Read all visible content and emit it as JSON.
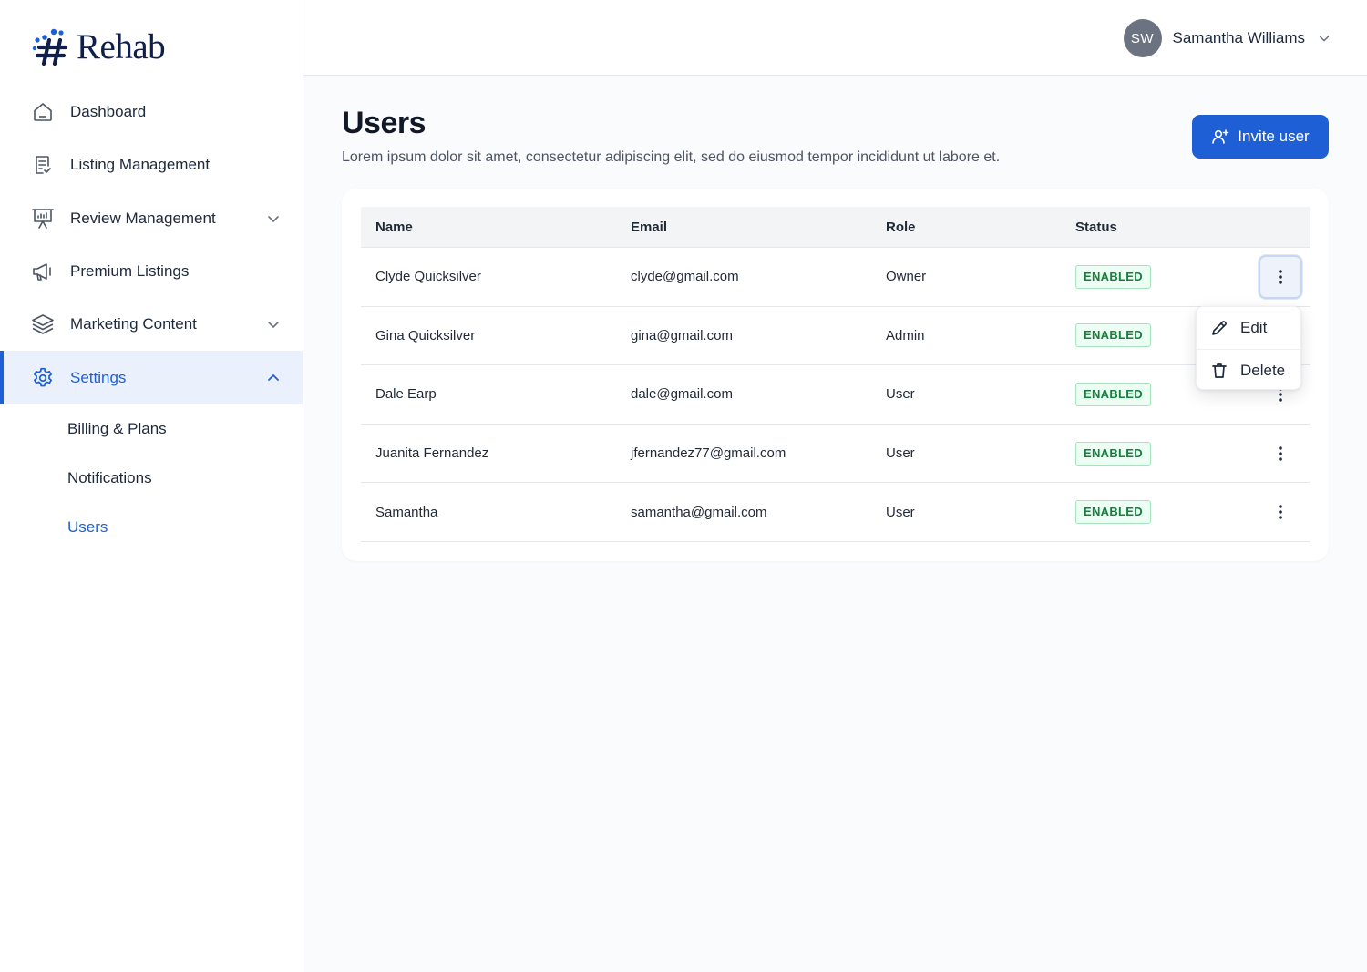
{
  "brand": {
    "name": "Rehab",
    "primary_color": "#1f5fd6"
  },
  "sidebar": {
    "items": [
      {
        "label": "Dashboard",
        "icon": "home-icon"
      },
      {
        "label": "Listing Management",
        "icon": "document-icon"
      },
      {
        "label": "Review Management",
        "icon": "presentation-icon",
        "expandable": true
      },
      {
        "label": "Premium Listings",
        "icon": "megaphone-icon"
      },
      {
        "label": "Marketing Content",
        "icon": "layers-icon",
        "expandable": true
      },
      {
        "label": "Settings",
        "icon": "gear-icon",
        "expandable": true,
        "expanded": true,
        "active": true
      }
    ],
    "subitems": [
      {
        "label": "Billing & Plans"
      },
      {
        "label": "Notifications"
      },
      {
        "label": "Users",
        "active": true
      }
    ]
  },
  "header": {
    "user": {
      "initials": "SW",
      "name": "Samantha Williams"
    }
  },
  "main": {
    "title": "Users",
    "description": "Lorem ipsum dolor sit amet, consectetur adipiscing elit, sed do eiusmod tempor incididunt ut labore et.",
    "invite_label": "Invite user",
    "table": {
      "columns": [
        "Name",
        "Email",
        "Role",
        "Status"
      ],
      "rows": [
        {
          "name": "Clyde Quicksilver",
          "email": "clyde@gmail.com",
          "role": "Owner",
          "status": "ENABLED"
        },
        {
          "name": "Gina Quicksilver",
          "email": "gina@gmail.com",
          "role": "Admin",
          "status": "ENABLED"
        },
        {
          "name": "Dale Earp",
          "email": "dale@gmail.com",
          "role": "User",
          "status": "ENABLED"
        },
        {
          "name": "Juanita Fernandez",
          "email": "jfernandez77@gmail.com",
          "role": "User",
          "status": "ENABLED"
        },
        {
          "name": "Samantha",
          "email": "samantha@gmail.com",
          "role": "User",
          "status": "ENABLED"
        }
      ]
    },
    "row_menu": {
      "open_row": 0,
      "items": [
        {
          "label": "Edit",
          "icon": "pencil-icon"
        },
        {
          "label": "Delete",
          "icon": "trash-icon"
        }
      ]
    }
  }
}
